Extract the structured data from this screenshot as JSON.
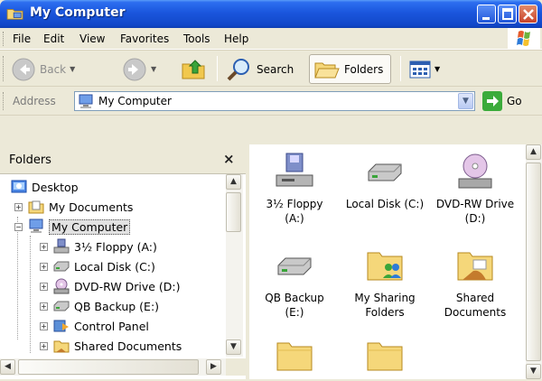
{
  "window": {
    "title": "My Computer",
    "icons": [
      "folder-computer-icon",
      "minimize-icon",
      "maximize-icon",
      "close-icon"
    ]
  },
  "menubar": {
    "items": [
      {
        "label": "File"
      },
      {
        "label": "Edit"
      },
      {
        "label": "View"
      },
      {
        "label": "Favorites"
      },
      {
        "label": "Tools"
      },
      {
        "label": "Help"
      }
    ]
  },
  "toolbar": {
    "back_label": "Back",
    "search_label": "Search",
    "folders_label": "Folders"
  },
  "address": {
    "label": "Address",
    "value": "My Computer",
    "go_label": "Go"
  },
  "folders_pane": {
    "title": "Folders",
    "close_glyph": "×",
    "tree": [
      {
        "label": "Desktop",
        "icon": "desktop-icon"
      },
      {
        "label": "My Documents",
        "icon": "my-documents-icon"
      },
      {
        "label": "My Computer",
        "icon": "my-computer-icon",
        "selected": true
      },
      {
        "label": "3½ Floppy (A:)",
        "icon": "floppy-icon"
      },
      {
        "label": "Local Disk (C:)",
        "icon": "hard-disk-icon"
      },
      {
        "label": "DVD-RW Drive (D:)",
        "icon": "dvd-drive-icon"
      },
      {
        "label": "QB Backup (E:)",
        "icon": "hard-disk-icon"
      },
      {
        "label": "Control Panel",
        "icon": "control-panel-icon"
      },
      {
        "label": "Shared Documents",
        "icon": "shared-folder-icon"
      }
    ]
  },
  "content": {
    "items": [
      {
        "line1": "3½ Floppy",
        "line2": "(A:)",
        "icon": "floppy-icon"
      },
      {
        "line1": "Local Disk (C:)",
        "line2": "",
        "icon": "hard-disk-icon"
      },
      {
        "line1": "DVD-RW Drive",
        "line2": "(D:)",
        "icon": "dvd-drive-icon"
      },
      {
        "line1": "QB Backup",
        "line2": "(E:)",
        "icon": "hard-disk-icon"
      },
      {
        "line1": "My Sharing",
        "line2": "Folders",
        "icon": "sharing-folder-icon"
      },
      {
        "line1": "Shared",
        "line2": "Documents",
        "icon": "shared-documents-icon"
      },
      {
        "line1": "",
        "line2": "",
        "icon": "folder-icon"
      },
      {
        "line1": "",
        "line2": "",
        "icon": "folder-icon"
      }
    ]
  },
  "colors": {
    "titlebar": "#1a56dd",
    "chrome": "#ece9d8",
    "address_border": "#7f9db9"
  }
}
